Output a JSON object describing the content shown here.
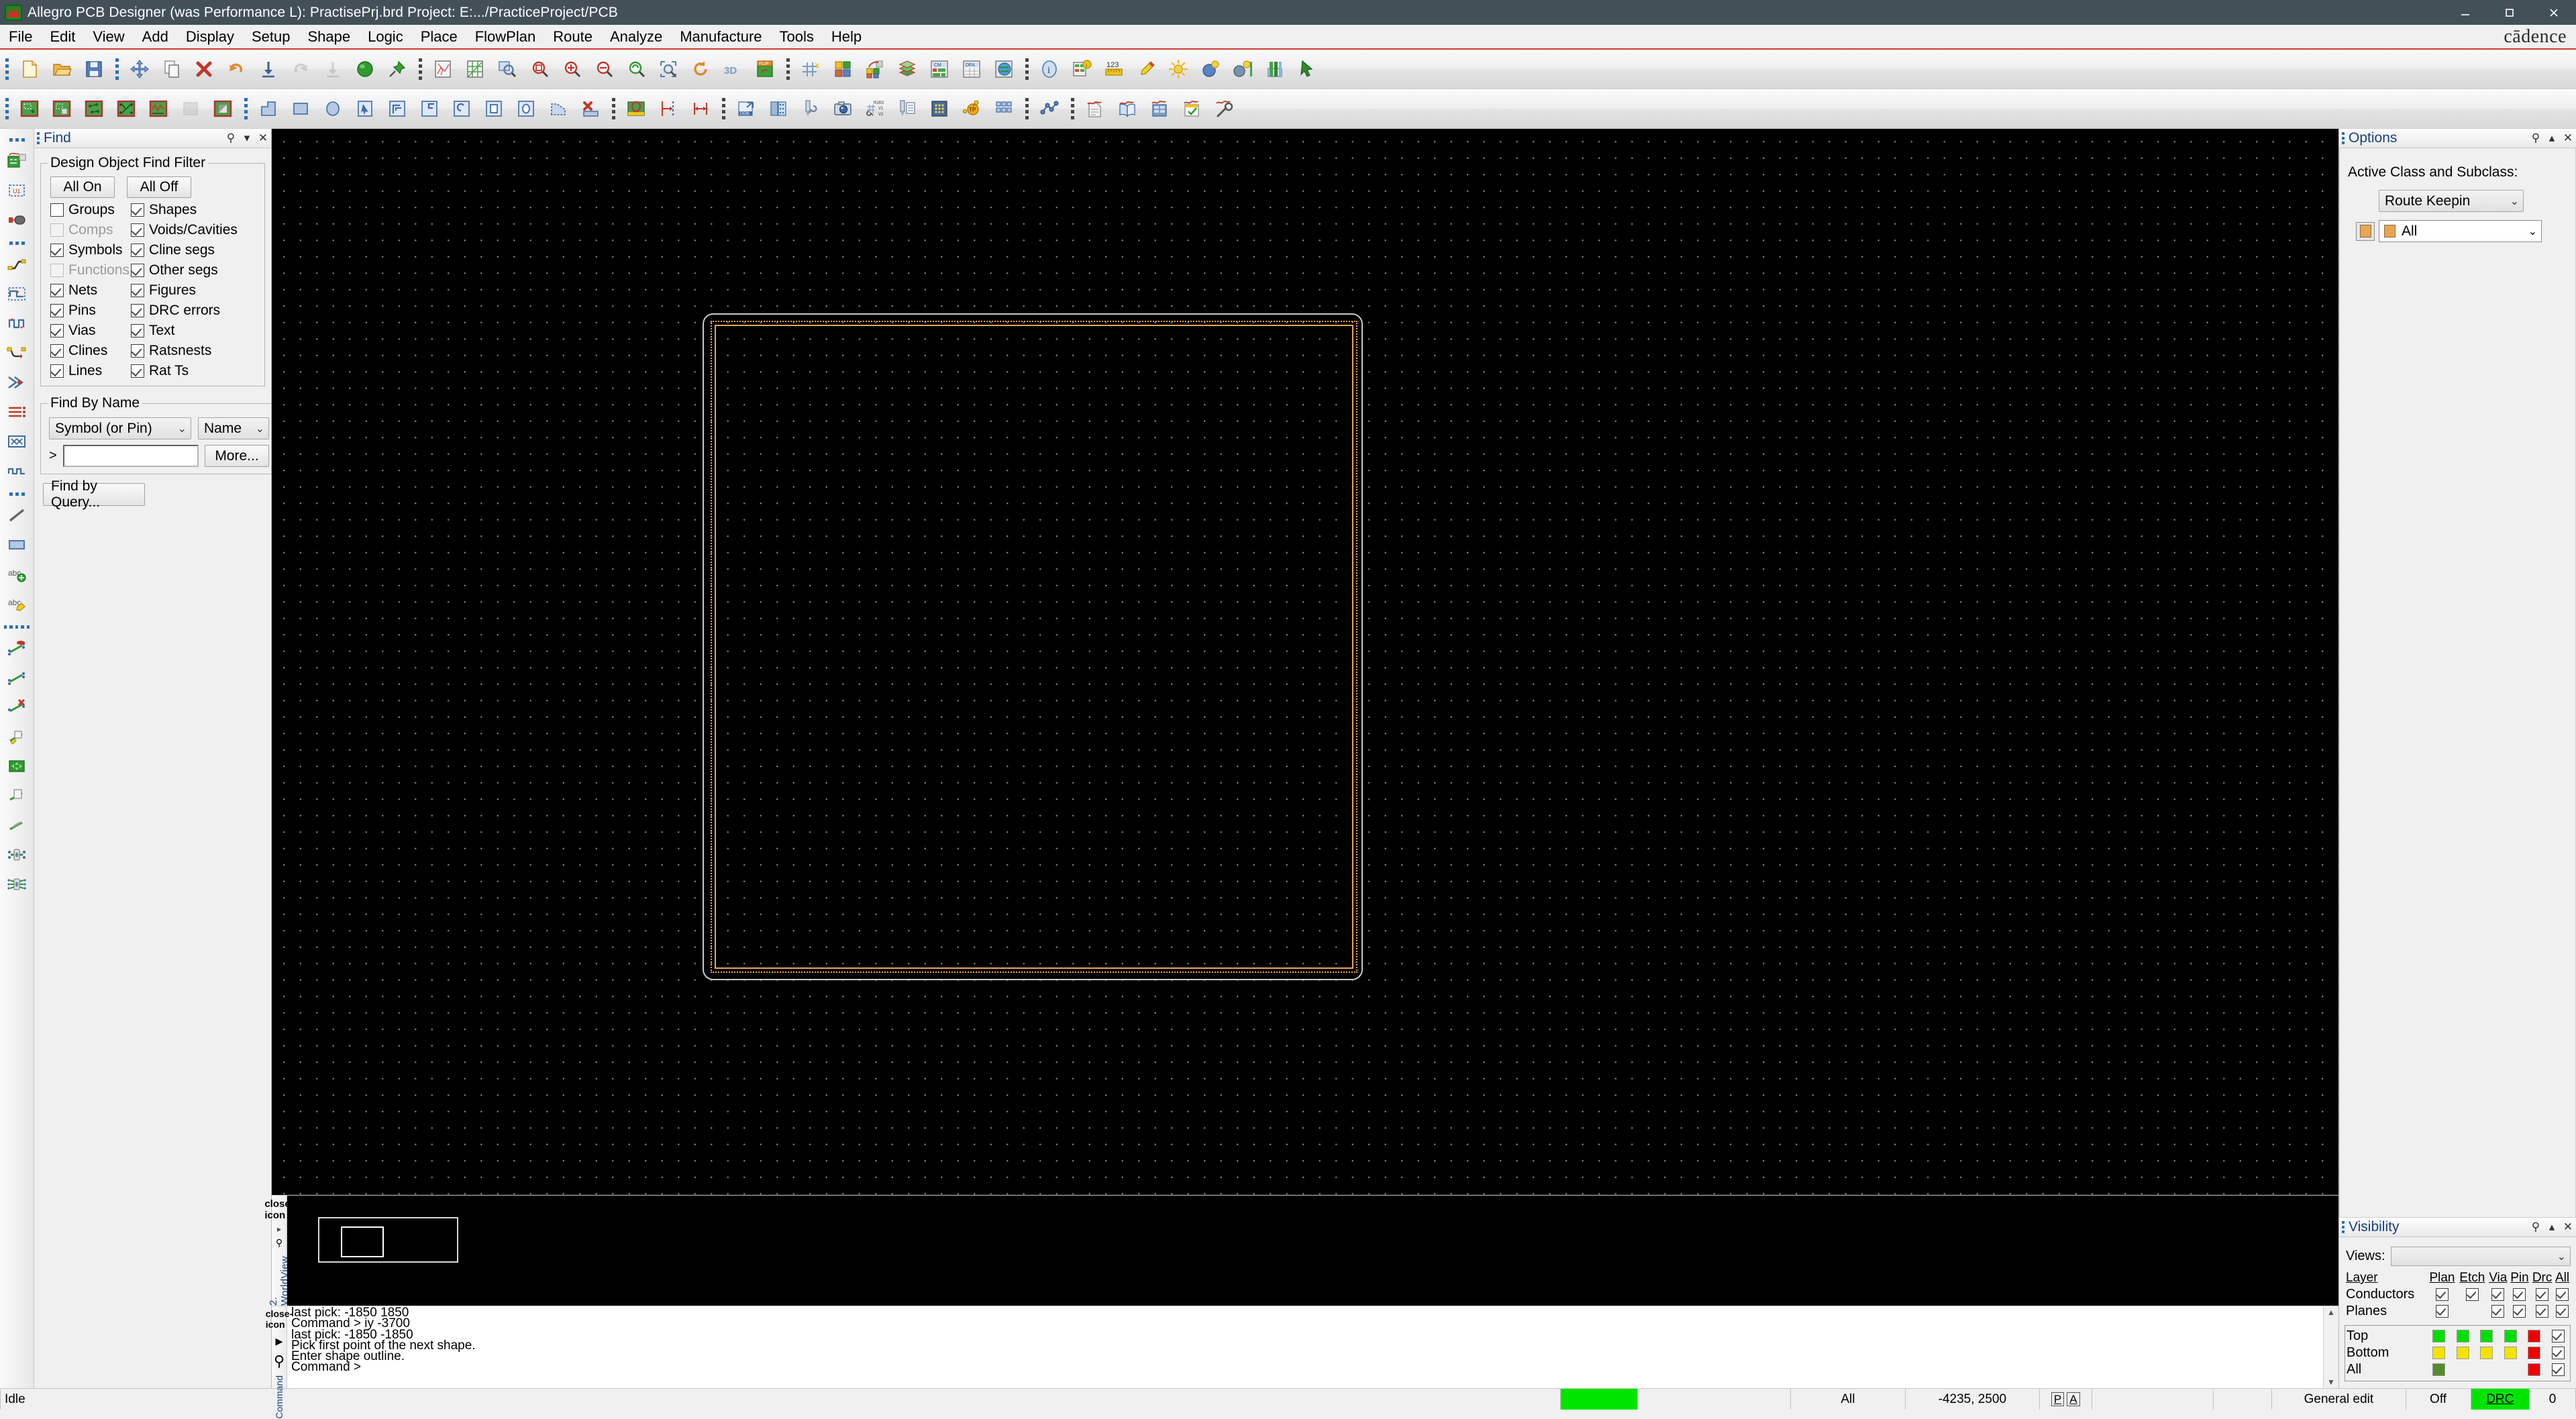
{
  "window": {
    "title": "Allegro PCB Designer (was Performance L): PractisePrj.brd  Project: E:.../PracticeProject/PCB",
    "app_icon": "allegro-icon",
    "minimize": "−",
    "maximize": "□",
    "close": "✕",
    "brand": "cādence"
  },
  "menubar": {
    "items": [
      {
        "label": "File",
        "accel": "F"
      },
      {
        "label": "Edit",
        "accel": "E"
      },
      {
        "label": "View",
        "accel": "V"
      },
      {
        "label": "Add",
        "accel": "A"
      },
      {
        "label": "Display",
        "accel": "D"
      },
      {
        "label": "Setup",
        "accel": "S"
      },
      {
        "label": "Shape",
        "accel": "S"
      },
      {
        "label": "Logic",
        "accel": "L"
      },
      {
        "label": "Place",
        "accel": "P"
      },
      {
        "label": "FlowPlan",
        "accel": "n"
      },
      {
        "label": "Route",
        "accel": "R"
      },
      {
        "label": "Analyze",
        "accel": "z"
      },
      {
        "label": "Manufacture",
        "accel": "M"
      },
      {
        "label": "Tools",
        "accel": "T"
      },
      {
        "label": "Help",
        "accel": "H"
      }
    ]
  },
  "toolbar_row1": [
    {
      "name": "new-file-icon",
      "group": 0
    },
    {
      "name": "open-file-icon",
      "group": 0
    },
    {
      "name": "save-icon",
      "group": 0
    },
    {
      "name": "move-icon",
      "group": 1
    },
    {
      "name": "copy-icon",
      "group": 1
    },
    {
      "name": "delete-icon",
      "group": 1
    },
    {
      "name": "undo-icon",
      "group": 1
    },
    {
      "name": "import-icon",
      "group": 1
    },
    {
      "name": "redo-icon",
      "group": 1,
      "disabled": true
    },
    {
      "name": "export-icon",
      "group": 1,
      "disabled": true
    },
    {
      "name": "net-icon",
      "group": 1
    },
    {
      "name": "pin-icon",
      "group": 1
    },
    {
      "name": "ratsnest-display-icon",
      "group": 2
    },
    {
      "name": "grid-display-icon",
      "group": 2
    },
    {
      "name": "zoom-fit-icon",
      "group": 2
    },
    {
      "name": "zoom-by-points-icon",
      "group": 2
    },
    {
      "name": "zoom-in-icon",
      "group": 2
    },
    {
      "name": "zoom-out-icon",
      "group": 2
    },
    {
      "name": "zoom-previous-icon",
      "group": 2
    },
    {
      "name": "zoom-selection-icon",
      "group": 2
    },
    {
      "name": "refresh-icon",
      "group": 2
    },
    {
      "name": "view-3d-icon",
      "group": 2
    },
    {
      "name": "flip-design-icon",
      "group": 2
    },
    {
      "name": "grid-toggle-icon",
      "group": 3
    },
    {
      "name": "color-visibility-icon",
      "group": 3
    },
    {
      "name": "subclass-move-icon",
      "group": 3
    },
    {
      "name": "layer-stackup-icon",
      "group": 3
    },
    {
      "name": "constraint-manager-icon",
      "group": 3
    },
    {
      "name": "dfa-icon",
      "group": 3
    },
    {
      "name": "global-view-icon",
      "group": 3
    },
    {
      "name": "show-element-icon",
      "group": 4
    },
    {
      "name": "show-measure-icon",
      "group": 4
    },
    {
      "name": "measure-icon",
      "group": 4
    },
    {
      "name": "highlight-icon",
      "group": 4
    },
    {
      "name": "dehighlight-icon",
      "group": 4
    },
    {
      "name": "color-view-icon",
      "group": 4
    },
    {
      "name": "layer-priority-icon",
      "group": 4
    },
    {
      "name": "hourglass-icon",
      "group": 4
    },
    {
      "name": "cancel-drag-icon",
      "group": 4
    }
  ],
  "toolbar_row2": [
    {
      "name": "place-manual-icon",
      "group": 0
    },
    {
      "name": "place-quickplace-icon",
      "group": 0
    },
    {
      "name": "swap-components-icon",
      "group": 0
    },
    {
      "name": "autoroute-icon",
      "group": 0
    },
    {
      "name": "signal-analysis-icon",
      "group": 0
    },
    {
      "name": "shape-blank-icon",
      "group": 0,
      "disabled": true
    },
    {
      "name": "shape-fill-icon",
      "group": 0
    },
    {
      "name": "shape-polygon-icon",
      "group": 1
    },
    {
      "name": "shape-rectangle-icon",
      "group": 1
    },
    {
      "name": "shape-circle-icon",
      "group": 1
    },
    {
      "name": "shape-select-icon",
      "group": 1
    },
    {
      "name": "shape-compose-icon",
      "group": 1
    },
    {
      "name": "shape-decompose-icon",
      "group": 1
    },
    {
      "name": "shape-edit-boundary-icon",
      "group": 1
    },
    {
      "name": "shape-void-rect-icon",
      "group": 1
    },
    {
      "name": "shape-void-circle-icon",
      "group": 1
    },
    {
      "name": "shape-void-polygon-icon",
      "group": 1
    },
    {
      "name": "shape-delete-icon",
      "group": 1
    },
    {
      "name": "drc-update-icon",
      "group": 2
    },
    {
      "name": "dimension-icon",
      "group": 2
    },
    {
      "name": "dimension-linear-icon",
      "group": 2
    },
    {
      "name": "odb-export-icon",
      "group": 3
    },
    {
      "name": "artwork-icon",
      "group": 3
    },
    {
      "name": "nc-drill-icon",
      "group": 3
    },
    {
      "name": "photoplot-icon",
      "group": 3
    },
    {
      "name": "backdrill-icon",
      "group": 3
    },
    {
      "name": "drill-legend-icon",
      "group": 3
    },
    {
      "name": "drill-report-icon",
      "group": 3
    },
    {
      "name": "testprep-bga-icon",
      "group": 3
    },
    {
      "name": "testpoint-icon",
      "group": 3
    },
    {
      "name": "array-icon",
      "group": 3
    },
    {
      "name": "signal-explorer-icon",
      "group": 4
    },
    {
      "name": "report-icon",
      "group": 5
    },
    {
      "name": "library-icon",
      "group": 5
    },
    {
      "name": "database-icon",
      "group": 5
    },
    {
      "name": "checklist-icon",
      "group": 5
    },
    {
      "name": "probe-icon",
      "group": 5
    }
  ],
  "left_toolbar": [
    {
      "name": "place-symbol-icon"
    },
    {
      "name": "place-refdes-icon"
    },
    {
      "name": "place-connector-icon"
    },
    {
      "name": "route-connect-icon"
    },
    {
      "name": "route-slide-icon"
    },
    {
      "name": "route-delay-tune-icon"
    },
    {
      "name": "route-custom-smooth-icon"
    },
    {
      "name": "route-fanout-icon"
    },
    {
      "name": "route-bus-icon"
    },
    {
      "name": "route-group-icon"
    },
    {
      "name": "route-spread-icon"
    },
    {
      "name": "add-line-icon"
    },
    {
      "name": "add-rectangle-icon"
    },
    {
      "name": "add-text-icon"
    },
    {
      "name": "edit-text-icon"
    },
    {
      "name": "net-schedule-icon"
    },
    {
      "name": "net-single-icon"
    },
    {
      "name": "net-delete-icon"
    },
    {
      "name": "net-edit-icon"
    },
    {
      "name": "net-move-icon"
    },
    {
      "name": "net-copy-icon"
    },
    {
      "name": "net-highlight-icon"
    },
    {
      "name": "net-assign-icon"
    },
    {
      "name": "net-bus-assign-icon"
    }
  ],
  "find_panel": {
    "title": "Find",
    "pin_icon": "pin-icon",
    "collapse_icon": "chevron-down-icon",
    "close_icon": "close-icon",
    "filter_legend": "Design Object Find Filter",
    "all_on": "All On",
    "all_off": "All Off",
    "filters_left": [
      {
        "label": "Groups",
        "checked": false,
        "disabled": false
      },
      {
        "label": "Comps",
        "checked": false,
        "disabled": true
      },
      {
        "label": "Symbols",
        "checked": true,
        "disabled": false
      },
      {
        "label": "Functions",
        "checked": false,
        "disabled": true
      },
      {
        "label": "Nets",
        "checked": true,
        "disabled": false
      },
      {
        "label": "Pins",
        "checked": true,
        "disabled": false
      },
      {
        "label": "Vias",
        "checked": true,
        "disabled": false
      },
      {
        "label": "Clines",
        "checked": true,
        "disabled": false
      },
      {
        "label": "Lines",
        "checked": true,
        "disabled": false
      }
    ],
    "filters_right": [
      {
        "label": "Shapes",
        "checked": true,
        "disabled": false
      },
      {
        "label": "Voids/Cavities",
        "checked": true,
        "disabled": false
      },
      {
        "label": "Cline segs",
        "checked": true,
        "disabled": false
      },
      {
        "label": "Other segs",
        "checked": true,
        "disabled": false
      },
      {
        "label": "Figures",
        "checked": true,
        "disabled": false
      },
      {
        "label": "DRC errors",
        "checked": true,
        "disabled": false
      },
      {
        "label": "Text",
        "checked": true,
        "disabled": false
      },
      {
        "label": "Ratsnests",
        "checked": true,
        "disabled": false
      },
      {
        "label": "Rat Ts",
        "checked": true,
        "disabled": false
      }
    ],
    "byname_legend": "Find By Name",
    "type_select": "Symbol (or Pin)",
    "scope_select": "Name",
    "prompt": ">",
    "name_value": "",
    "more_button": "More...",
    "find_by_query": "Find by Query..."
  },
  "options_panel": {
    "title": "Options",
    "pin_icon": "pin-icon",
    "collapse_icon": "chevron-up-icon",
    "close_icon": "close-icon",
    "active_label": "Active Class and Subclass:",
    "class_value": "Route Keepin",
    "subclass_value": "All",
    "subclass_color": "#e8a552"
  },
  "visibility_panel": {
    "title": "Visibility",
    "pin_icon": "pin-icon",
    "collapse_icon": "chevron-up-icon",
    "close_icon": "close-icon",
    "views_label": "Views:",
    "views_value": "",
    "columns": [
      "Layer",
      "Plan",
      "Etch",
      "Via",
      "Pin",
      "Drc",
      "All"
    ],
    "rows": [
      {
        "label": "Conductors",
        "cells": [
          {
            "type": "check",
            "on": true
          },
          {
            "type": "check",
            "on": true
          },
          {
            "type": "check",
            "on": true
          },
          {
            "type": "check",
            "on": true
          },
          {
            "type": "check",
            "on": true
          },
          {
            "type": "check",
            "on": true
          }
        ]
      },
      {
        "label": "Planes",
        "cells": [
          {
            "type": "check",
            "on": true
          },
          {
            "type": "empty"
          },
          {
            "type": "check",
            "on": true
          },
          {
            "type": "check",
            "on": true
          },
          {
            "type": "check",
            "on": true
          },
          {
            "type": "check",
            "on": true
          },
          {
            "type": "check",
            "on": true
          }
        ]
      }
    ],
    "layer_rows": [
      {
        "label": "Top",
        "cells": [
          {
            "type": "swatch",
            "color": "#00e000"
          },
          {
            "type": "swatch",
            "color": "#00e000"
          },
          {
            "type": "swatch",
            "color": "#00e000"
          },
          {
            "type": "swatch",
            "color": "#00e000"
          },
          {
            "type": "swatch",
            "color": "#ee0000"
          },
          {
            "type": "check",
            "on": true
          }
        ]
      },
      {
        "label": "Bottom",
        "cells": [
          {
            "type": "swatch",
            "color": "#f2e300"
          },
          {
            "type": "swatch",
            "color": "#f2e300"
          },
          {
            "type": "swatch",
            "color": "#f2e300"
          },
          {
            "type": "swatch",
            "color": "#f2e300"
          },
          {
            "type": "swatch",
            "color": "#ee0000"
          },
          {
            "type": "check",
            "on": true
          }
        ]
      },
      {
        "label": "All",
        "cells": [
          {
            "type": "swatch",
            "color": "#558b2f"
          },
          {
            "type": "empty"
          },
          {
            "type": "empty"
          },
          {
            "type": "empty"
          },
          {
            "type": "swatch",
            "color": "#ee0000"
          },
          {
            "type": "check",
            "on": true
          }
        ]
      }
    ]
  },
  "worldview": {
    "label": "2. WorldView",
    "close_icon": "close-icon",
    "expand_icon": "chevron-right-icon",
    "pin_icon": "pin-icon"
  },
  "console": {
    "label": "Command",
    "close_icon": "close-icon",
    "expand_icon": "chevron-right-icon",
    "pin_icon": "pin-icon",
    "lines": [
      "last pick:  -1850 1850",
      "Command > iy -3700",
      "last pick:  -1850 -1850",
      "Pick first point of the next shape.",
      "Enter shape outline.",
      "Command >"
    ],
    "scroll_up": "▲",
    "scroll_down": "▼"
  },
  "statusbar": {
    "message": "Idle",
    "progress_color": "#00e500",
    "active_layer": "All",
    "coordinates": "-4235, 2500",
    "pick_mode": [
      "P",
      "A"
    ],
    "mode": "General edit",
    "snap": "Off",
    "drc_label": "DRC",
    "drc_color": "#00e500",
    "drc_count": "0"
  },
  "canvas": {
    "background": "#000000",
    "grid_dot_color": "#cfcfcf",
    "board_outline_color": "#c9c9c9",
    "route_keepin_color": "#e8a552"
  }
}
